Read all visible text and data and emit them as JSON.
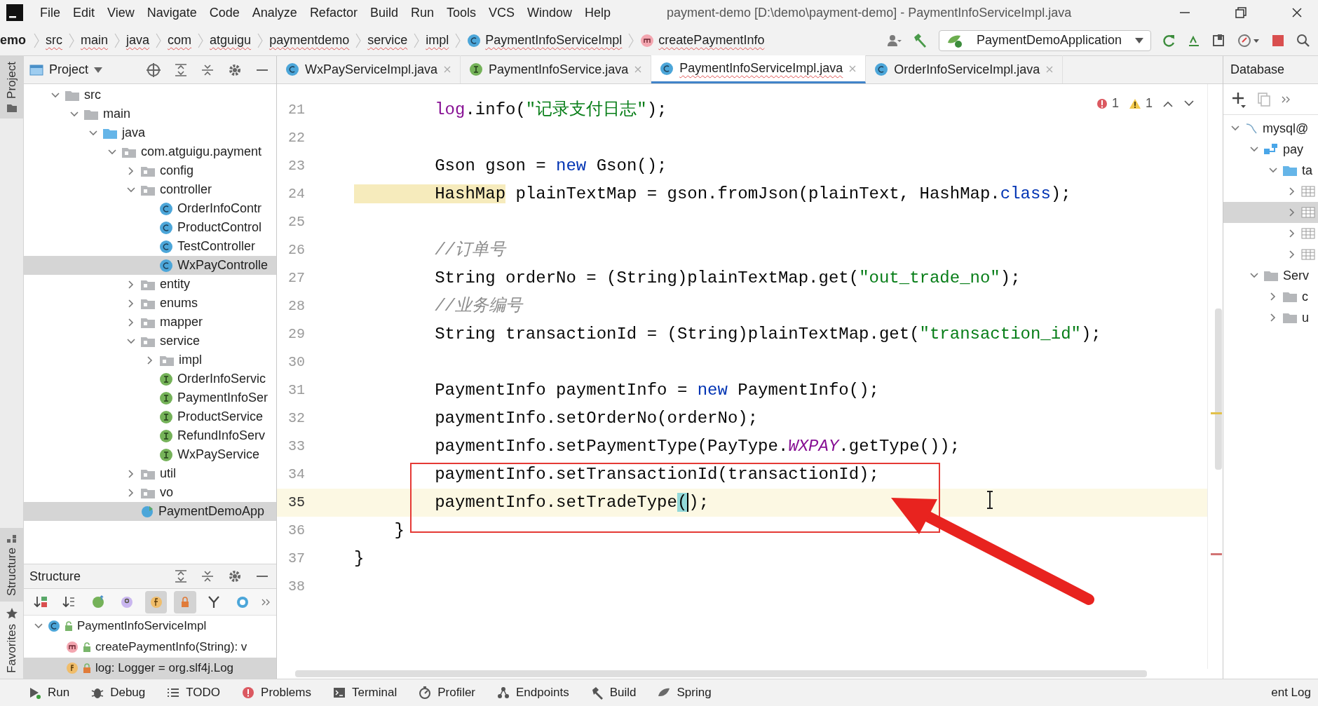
{
  "menu": [
    "File",
    "Edit",
    "View",
    "Navigate",
    "Code",
    "Analyze",
    "Refactor",
    "Build",
    "Run",
    "Tools",
    "VCS",
    "Window",
    "Help"
  ],
  "window": {
    "title": "payment-demo [D:\\demo\\payment-demo] - PaymentInfoServiceImpl.java"
  },
  "breadcrumb": [
    {
      "label": "emo",
      "kind": "project"
    },
    {
      "label": "src",
      "kind": "dir"
    },
    {
      "label": "main",
      "kind": "dir"
    },
    {
      "label": "java",
      "kind": "dir"
    },
    {
      "label": "com",
      "kind": "dir"
    },
    {
      "label": "atguigu",
      "kind": "dir"
    },
    {
      "label": "paymentdemo",
      "kind": "dir"
    },
    {
      "label": "service",
      "kind": "dir"
    },
    {
      "label": "impl",
      "kind": "dir"
    },
    {
      "label": "PaymentInfoServiceImpl",
      "kind": "class"
    },
    {
      "label": "createPaymentInfo",
      "kind": "method"
    }
  ],
  "run_config": {
    "label": "PaymentDemoApplication"
  },
  "side_tabs": [
    {
      "label": "Project",
      "selected": true,
      "kind": "project"
    },
    {
      "label": "Structure",
      "selected": true,
      "kind": "structure"
    },
    {
      "label": "Favorites",
      "selected": false,
      "kind": "favorites"
    }
  ],
  "project": {
    "title": "Project",
    "tree": [
      {
        "label": "src",
        "kind": "folder",
        "expanded": true,
        "selected": false,
        "children": [
          {
            "label": "main",
            "kind": "folder",
            "expanded": true,
            "selected": false,
            "children": [
              {
                "label": "java",
                "kind": "bluefolder",
                "expanded": true,
                "selected": false,
                "children": [
                  {
                    "label": "com.atguigu.payment",
                    "kind": "package",
                    "expanded": true,
                    "selected": false,
                    "children": [
                      {
                        "label": "config",
                        "kind": "package",
                        "expanded": false,
                        "selected": false
                      },
                      {
                        "label": "controller",
                        "kind": "package",
                        "expanded": true,
                        "selected": false,
                        "children": [
                          {
                            "label": "OrderInfoContr",
                            "kind": "class",
                            "selected": false
                          },
                          {
                            "label": "ProductControl",
                            "kind": "class",
                            "selected": false
                          },
                          {
                            "label": "TestController",
                            "kind": "class",
                            "selected": false
                          },
                          {
                            "label": "WxPayControlle",
                            "kind": "class",
                            "selected": true
                          }
                        ]
                      },
                      {
                        "label": "entity",
                        "kind": "package",
                        "expanded": false,
                        "selected": false
                      },
                      {
                        "label": "enums",
                        "kind": "package",
                        "expanded": false,
                        "selected": false
                      },
                      {
                        "label": "mapper",
                        "kind": "package",
                        "expanded": false,
                        "selected": false
                      },
                      {
                        "label": "service",
                        "kind": "package",
                        "expanded": true,
                        "selected": false,
                        "children": [
                          {
                            "label": "impl",
                            "kind": "package",
                            "expanded": false,
                            "selected": false
                          },
                          {
                            "label": "OrderInfoServic",
                            "kind": "interface",
                            "selected": false
                          },
                          {
                            "label": "PaymentInfoSer",
                            "kind": "interface",
                            "selected": false
                          },
                          {
                            "label": "ProductService",
                            "kind": "interface",
                            "selected": false
                          },
                          {
                            "label": "RefundInfoServ",
                            "kind": "interface",
                            "selected": false
                          },
                          {
                            "label": "WxPayService",
                            "kind": "interface",
                            "selected": false
                          }
                        ]
                      },
                      {
                        "label": "util",
                        "kind": "package",
                        "expanded": false,
                        "selected": false
                      },
                      {
                        "label": "vo",
                        "kind": "package",
                        "expanded": false,
                        "selected": false
                      },
                      {
                        "label": "PaymentDemoApp",
                        "kind": "app",
                        "selected": true
                      }
                    ]
                  }
                ]
              }
            ]
          }
        ]
      }
    ]
  },
  "structure": {
    "title": "Structure",
    "toggles": [
      {
        "kind": "sort-visibility",
        "selected": false
      },
      {
        "kind": "sort-alpha",
        "selected": false
      },
      {
        "kind": "inherited",
        "selected": false
      },
      {
        "kind": "properties",
        "selected": false
      },
      {
        "kind": "fields",
        "selected": true
      },
      {
        "kind": "non-public",
        "selected": true
      },
      {
        "kind": "lambdas",
        "selected": false
      },
      {
        "kind": "anonymous",
        "selected": false
      }
    ],
    "tree": [
      {
        "label": "PaymentInfoServiceImpl",
        "kind": "class",
        "expanded": true,
        "selected": false,
        "children": [
          {
            "label": "createPaymentInfo(String): v",
            "kind": "method",
            "selected": false
          },
          {
            "label": "log: Logger = org.slf4j.Log",
            "kind": "field",
            "selected": true
          }
        ]
      }
    ]
  },
  "tabs": [
    {
      "label": "WxPayServiceImpl.java",
      "kind": "class",
      "selected": false
    },
    {
      "label": "PaymentInfoService.java",
      "kind": "interface",
      "selected": false
    },
    {
      "label": "PaymentInfoServiceImpl.java",
      "kind": "class",
      "selected": true
    },
    {
      "label": "OrderInfoServiceImpl.java",
      "kind": "class",
      "selected": false
    }
  ],
  "inspections": {
    "errors": "1",
    "warnings": "1"
  },
  "code": [
    {
      "number": "21",
      "current": false,
      "tokens": [
        {
          "text": "        log",
          "kind": "field"
        },
        {
          "text": ".info(",
          "kind": "plain"
        },
        {
          "text": "\"记录支付日志\"",
          "kind": "string"
        },
        {
          "text": ");",
          "kind": "plain"
        }
      ]
    },
    {
      "number": "22",
      "current": false
    },
    {
      "number": "23",
      "current": false,
      "tokens": [
        {
          "text": "        Gson gson = ",
          "kind": "plain"
        },
        {
          "text": "new",
          "kind": "keyword"
        },
        {
          "text": " Gson();",
          "kind": "plain"
        }
      ]
    },
    {
      "number": "24",
      "current": false,
      "tokens": [
        {
          "text": "        HashMap",
          "kind": "warning"
        },
        {
          "text": " plainTextMap = gson.fromJson(plainText, HashMap.",
          "kind": "plain"
        },
        {
          "text": "class",
          "kind": "keyword"
        },
        {
          "text": ");",
          "kind": "plain"
        }
      ]
    },
    {
      "number": "25",
      "current": false
    },
    {
      "number": "26",
      "current": false,
      "tokens": [
        {
          "text": "        //订单号",
          "kind": "comment"
        }
      ]
    },
    {
      "number": "27",
      "current": false,
      "tokens": [
        {
          "text": "        String orderNo = (String)plainTextMap.get(",
          "kind": "plain"
        },
        {
          "text": "\"out_trade_no\"",
          "kind": "string"
        },
        {
          "text": ");",
          "kind": "plain"
        }
      ]
    },
    {
      "number": "28",
      "current": false,
      "tokens": [
        {
          "text": "        //业务编号",
          "kind": "comment"
        }
      ]
    },
    {
      "number": "29",
      "current": false,
      "tokens": [
        {
          "text": "        String transactionId = (String)plainTextMap.get(",
          "kind": "plain"
        },
        {
          "text": "\"transaction_id\"",
          "kind": "string"
        },
        {
          "text": ");",
          "kind": "plain"
        }
      ]
    },
    {
      "number": "30",
      "current": false
    },
    {
      "number": "31",
      "current": false,
      "tokens": [
        {
          "text": "        PaymentInfo paymentInfo = ",
          "kind": "plain"
        },
        {
          "text": "new",
          "kind": "keyword"
        },
        {
          "text": " PaymentInfo();",
          "kind": "plain"
        }
      ]
    },
    {
      "number": "32",
      "current": false,
      "tokens": [
        {
          "text": "        paymentInfo.setOrderNo(orderNo);",
          "kind": "plain"
        }
      ]
    },
    {
      "number": "33",
      "current": false,
      "tokens": [
        {
          "text": "        paymentInfo.setPaymentType(PayType.",
          "kind": "plain"
        },
        {
          "text": "WXPAY",
          "kind": "static"
        },
        {
          "text": ".getType());",
          "kind": "plain"
        }
      ]
    },
    {
      "number": "34",
      "current": false,
      "tokens": [
        {
          "text": "        paymentInfo.setTransactionId(transactionId);",
          "kind": "plain"
        }
      ]
    },
    {
      "number": "35",
      "current": true,
      "tokens": [
        {
          "text": "        paymentInfo.setTradeType",
          "kind": "plain"
        },
        {
          "text": "(",
          "kind": "match"
        },
        {
          "text": ");",
          "kind": "plain"
        }
      ]
    },
    {
      "number": "36",
      "current": false,
      "tokens": [
        {
          "text": "    }",
          "kind": "plain"
        }
      ]
    },
    {
      "number": "37",
      "current": false,
      "tokens": [
        {
          "text": "}",
          "kind": "plain"
        }
      ]
    },
    {
      "number": "38",
      "current": false
    }
  ],
  "annotations": [
    {
      "kind": "box"
    },
    {
      "kind": "arrow"
    }
  ],
  "database": {
    "title": "Database",
    "tree": [
      {
        "label": "mysql@",
        "kind": "datasource",
        "expanded": true,
        "selected": false,
        "children": [
          {
            "label": "pay",
            "kind": "schema",
            "expanded": true,
            "selected": false,
            "children": [
              {
                "label": "ta",
                "kind": "bluefolder",
                "expanded": true,
                "selected": false,
                "children": [
                  {
                    "kind": "table",
                    "expanded": false,
                    "selected": false
                  },
                  {
                    "kind": "table",
                    "expanded": false,
                    "selected": true
                  },
                  {
                    "kind": "table",
                    "expanded": false,
                    "selected": false
                  },
                  {
                    "kind": "table",
                    "expanded": false,
                    "selected": false
                  }
                ]
              }
            ]
          },
          {
            "label": "Serv",
            "kind": "folder",
            "expanded": true,
            "selected": false,
            "children": [
              {
                "label": "c",
                "kind": "folder",
                "expanded": false,
                "selected": false
              },
              {
                "label": "u",
                "kind": "folder",
                "expanded": false,
                "selected": false
              }
            ]
          }
        ]
      }
    ]
  },
  "bottom_tools": [
    {
      "label": "Run",
      "kind": "run"
    },
    {
      "label": "Debug",
      "kind": "debug"
    },
    {
      "label": "TODO",
      "kind": "todo"
    },
    {
      "label": "Problems",
      "kind": "problems"
    },
    {
      "label": "Terminal",
      "kind": "terminal"
    },
    {
      "label": "Profiler",
      "kind": "profiler"
    },
    {
      "label": "Endpoints",
      "kind": "endpoints"
    },
    {
      "label": "Build",
      "kind": "build"
    },
    {
      "label": "Spring",
      "kind": "spring"
    }
  ],
  "event_log": {
    "label": "ent Log"
  }
}
